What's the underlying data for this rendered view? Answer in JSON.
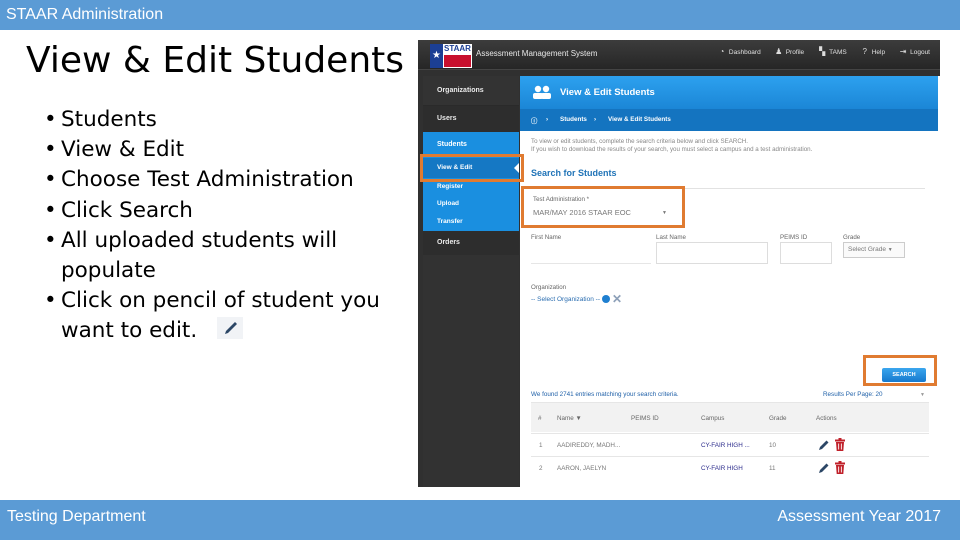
{
  "slide": {
    "header": "STAAR Administration",
    "title": "View & Edit Students",
    "bullets": [
      "Students",
      "View & Edit",
      "Choose Test Administration",
      "Click Search",
      "All uploaded students will populate",
      "Click on pencil of student you want to edit."
    ],
    "footer_left": "Testing Department",
    "footer_right": "Assessment Year 2017"
  },
  "app": {
    "logo_text": "STAAR",
    "name": "Assessment Management System",
    "topnav": [
      {
        "label": "Dashboard",
        "icon": "dashboard-icon"
      },
      {
        "label": "Profile",
        "icon": "user-icon"
      },
      {
        "label": "TAMS",
        "icon": "tams-icon"
      },
      {
        "label": "Help",
        "icon": "help-icon"
      },
      {
        "label": "Logout",
        "icon": "logout-icon"
      }
    ],
    "sidebar": {
      "organizations": "Organizations",
      "users": "Users",
      "students": "Students",
      "view_edit": "View & Edit",
      "register": "Register",
      "upload": "Upload",
      "transfer": "Transfer",
      "orders": "Orders"
    },
    "page_title": "View & Edit Students",
    "breadcrumb": {
      "home_icon": "home-icon",
      "level1": "Students",
      "level2": "View & Edit Students"
    },
    "intro_line1": "To view or edit students, complete the search criteria below and click SEARCH.",
    "intro_line2": "If you wish to download the results of your search, you must select a campus and a test administration.",
    "search_heading": "Search for Students",
    "form": {
      "test_admin_label": "Test Administration *",
      "test_admin_value": "MAR/MAY 2016 STAAR EOC",
      "first_name_label": "First Name",
      "last_name_label": "Last Name",
      "peims_label": "PEIMS ID",
      "grade_label": "Grade",
      "grade_value": "Select Grade",
      "organization_label": "Organization",
      "organization_value": "-- Select Organization --"
    },
    "search_button": "SEARCH",
    "results_text": "We found 2741 entries matching your search criteria.",
    "results_per_page_label": "Results Per Page:",
    "results_per_page_value": "20",
    "table": {
      "headers": [
        "#",
        "Name",
        "PEIMS ID",
        "Campus",
        "Grade",
        "Actions"
      ],
      "rows": [
        {
          "num": "1",
          "name": "AADIREDDY, MADH...",
          "peims": "",
          "campus": "CY-FAIR HIGH ...",
          "grade": "10"
        },
        {
          "num": "2",
          "name": "AARON, JAELYN",
          "peims": "",
          "campus": "CY-FAIR HIGH",
          "grade": "11"
        }
      ]
    },
    "colors": {
      "accent": "#1a8fe0",
      "highlight": "#e07b31",
      "delete": "#c0202a"
    }
  }
}
